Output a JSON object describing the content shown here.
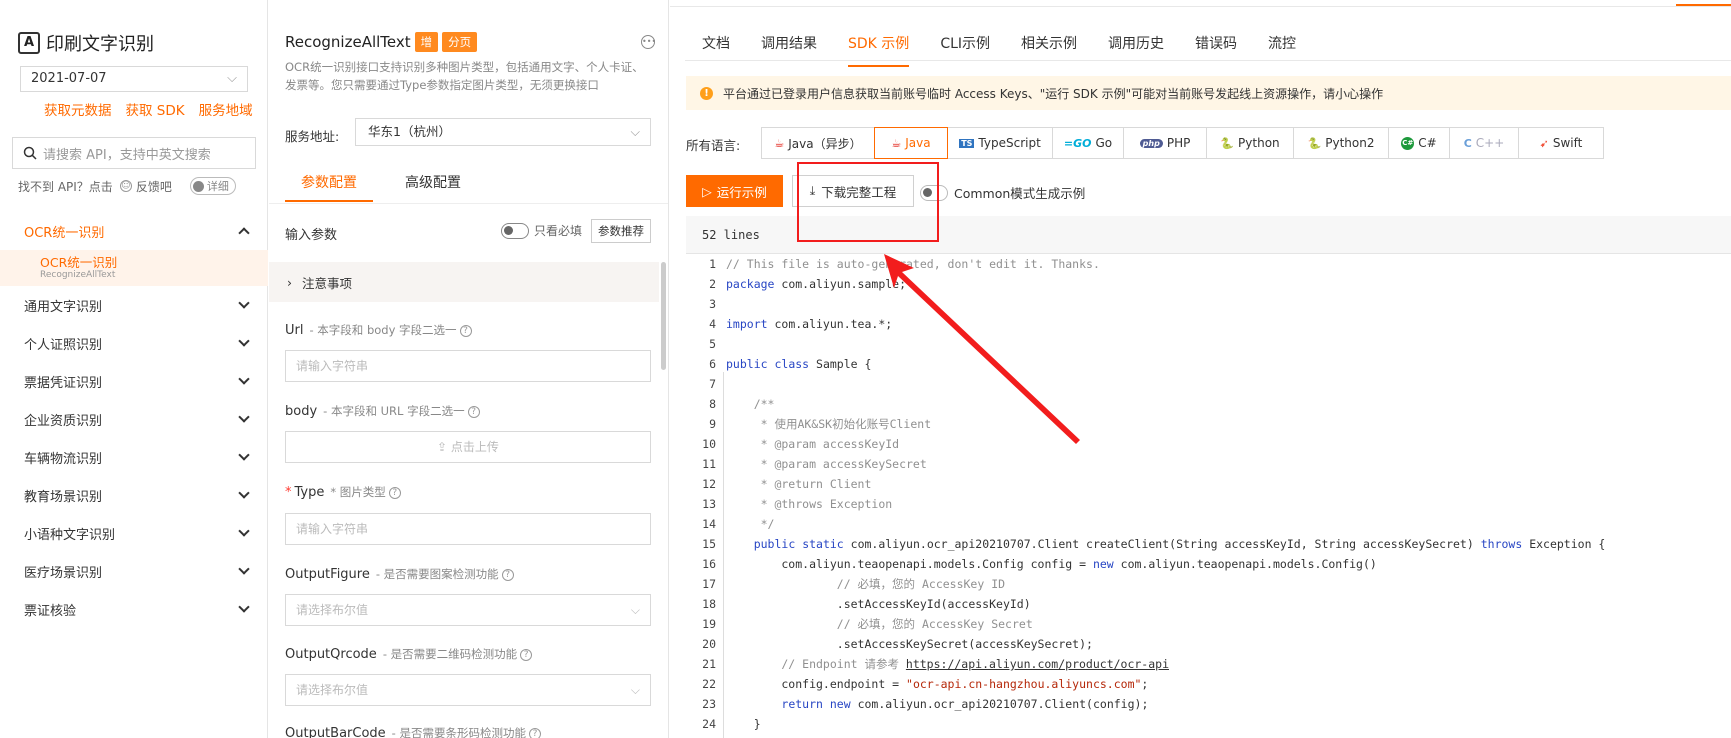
{
  "sidebar": {
    "title": "印刷文字识别",
    "version": "2021-07-07",
    "links": [
      "获取元数据",
      "获取 SDK",
      "服务地域"
    ],
    "search_placeholder": "请搜索 API，支持中英文搜索",
    "feedback_text": "找不到 API？点击",
    "feedback_link": "反馈吧",
    "detail_toggle": "详细",
    "open_group": "OCR统一识别",
    "open_sub_title": "OCR统一识别",
    "open_sub_subtitle": "RecognizeAllText",
    "groups": [
      "通用文字识别",
      "个人证照识别",
      "票据凭证识别",
      "企业资质识别",
      "车辆物流识别",
      "教育场景识别",
      "小语种文字识别",
      "医疗场景识别",
      "票证核验"
    ]
  },
  "api": {
    "name": "RecognizeAllText",
    "tag_add": "增",
    "tag_page": "分页",
    "desc": "OCR统一识别接口支持识别多种图片类型，包括通用文字、个人卡证、发票等。您只需要通过Type参数指定图片类型，无须更换接口",
    "endpoint_label": "服务地址:",
    "endpoint_value": "华东1（杭州）",
    "tab_params": "参数配置",
    "tab_advanced": "高级配置",
    "input_params": "输入参数",
    "required_only": "只看必填",
    "recommend": "参数推荐",
    "notes": "注意事项",
    "fields": {
      "url": {
        "name": "Url",
        "note": "- 本字段和 body 字段二选一",
        "placeholder": "请输入字符串"
      },
      "body": {
        "name": "body",
        "note": "- 本字段和 URL 字段二选一",
        "placeholder": "点击上传"
      },
      "type": {
        "req": "*",
        "name": "Type",
        "note": "* 图片类型",
        "placeholder": "请输入字符串"
      },
      "figure": {
        "name": "OutputFigure",
        "note": "- 是否需要图案检测功能",
        "placeholder": "请选择布尔值"
      },
      "qrcode": {
        "name": "OutputQrcode",
        "note": "- 是否需要二维码检测功能",
        "placeholder": "请选择布尔值"
      },
      "barcode": {
        "name": "OutputBarCode",
        "note": "- 是否需要条形码检测功能"
      }
    }
  },
  "doc": {
    "tabs": [
      "文档",
      "调用结果",
      "SDK 示例",
      "CLI示例",
      "相关示例",
      "调用历史",
      "错误码",
      "流控"
    ],
    "active_tab": "SDK 示例",
    "warning": "平台通过已登录用户信息获取当前账号临时 Access Keys、\"运行 SDK 示例\"可能对当前账号发起线上资源操作，请小心操作",
    "lang_label": "所有语言:",
    "languages": [
      {
        "label": "Java（异步）",
        "icon": "java-cup-icon"
      },
      {
        "label": "Java",
        "icon": "java-cup-icon"
      },
      {
        "label": "TypeScript",
        "icon": "ts-icon"
      },
      {
        "label": "Go",
        "icon": "go-icon"
      },
      {
        "label": "PHP",
        "icon": "php-icon"
      },
      {
        "label": "Python",
        "icon": "python-icon"
      },
      {
        "label": "Python2",
        "icon": "python-icon"
      },
      {
        "label": "C#",
        "icon": "csharp-icon"
      },
      {
        "label": "C++",
        "icon": "cpp-icon"
      },
      {
        "label": "Swift",
        "icon": "swift-icon"
      }
    ],
    "active_language": "Java",
    "run_btn": "运行示例",
    "download_btn": "下载完整工程",
    "common_toggle": "Common模式生成示例",
    "lines_count": "52 lines",
    "code": [
      "// This file is auto-generated, don't edit it. Thanks.",
      "package com.aliyun.sample;",
      "",
      "import com.aliyun.tea.*;",
      "",
      "public class Sample {",
      "",
      "    /**",
      "     * 使用AK&SK初始化账号Client",
      "     * @param accessKeyId",
      "     * @param accessKeySecret",
      "     * @return Client",
      "     * @throws Exception",
      "     */",
      "    public static com.aliyun.ocr_api20210707.Client createClient(String accessKeyId, String accessKeySecret) throws Exception {",
      "        com.aliyun.teaopenapi.models.Config config = new com.aliyun.teaopenapi.models.Config()",
      "                // 必填，您的 AccessKey ID",
      "                .setAccessKeyId(accessKeyId)",
      "                // 必填，您的 AccessKey Secret",
      "                .setAccessKeySecret(accessKeySecret);",
      "        // Endpoint 请参考 https://api.aliyun.com/product/ocr-api",
      "        config.endpoint = \"ocr-api.cn-hangzhou.aliyuncs.com\";",
      "        return new com.aliyun.ocr_api20210707.Client(config);",
      "    }"
    ]
  },
  "colors": {
    "accent": "#ff6a00",
    "annotation": "#f21d1d"
  }
}
